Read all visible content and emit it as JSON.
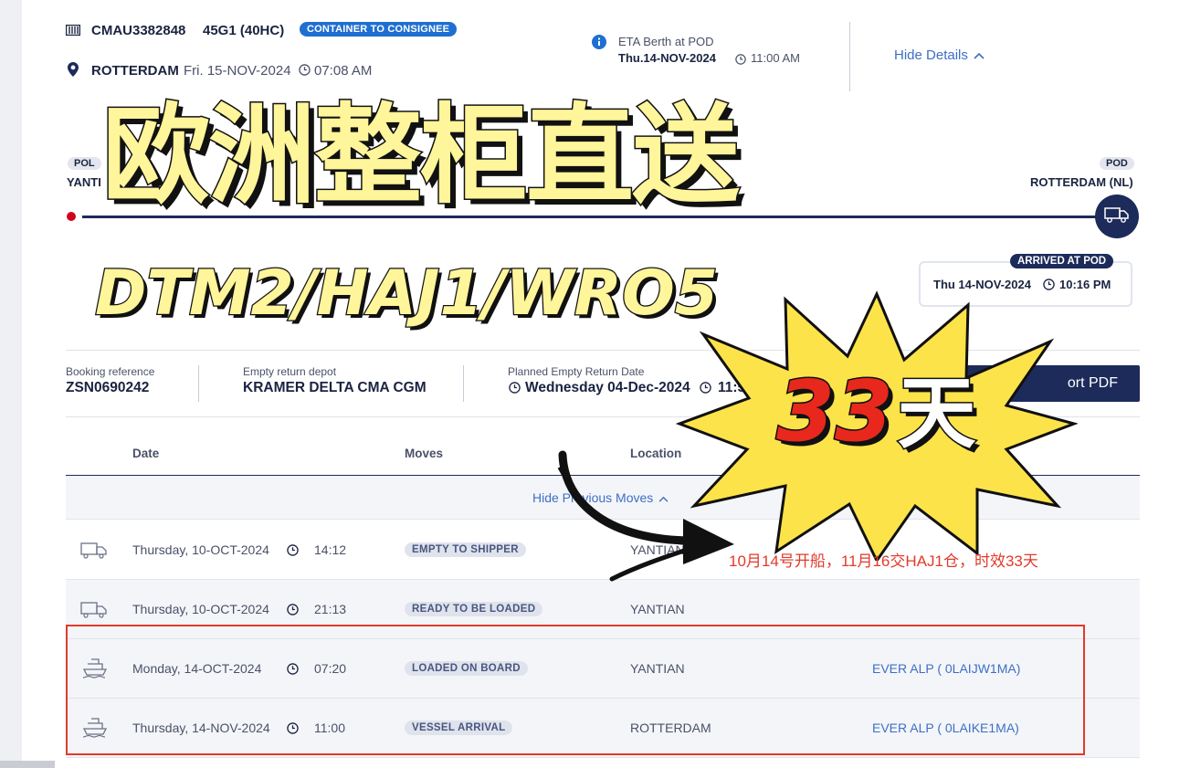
{
  "header": {
    "container_id": "CMAU3382848",
    "container_type": "45G1 (40HC)",
    "status_badge": "CONTAINER TO CONSIGNEE",
    "location": "ROTTERDAM",
    "location_date": "Fri. 15-NOV-2024",
    "location_time": "07:08 AM",
    "eta_label": "ETA Berth at POD",
    "eta_date": "Thu.14-NOV-2024",
    "eta_time": "11:00 AM",
    "hide_details": "Hide Details"
  },
  "route": {
    "pol_tag": "POL",
    "pol_name": "YANTI",
    "pod_tag": "POD",
    "pod_name": "ROTTERDAM (NL)",
    "arrived_tag": "ARRIVED AT POD",
    "arrived_date": "Thu 14-NOV-2024",
    "arrived_time": "10:16 PM"
  },
  "info": {
    "booking_label": "Booking reference",
    "booking_value": "ZSN0690242",
    "depot_label": "Empty return depot",
    "depot_value": "KRAMER DELTA CMA CGM",
    "planned_label": "Planned Empty Return Date",
    "planned_date": "Wednesday 04-Dec-2024",
    "planned_time": "11:5",
    "export_label": "ort PDF"
  },
  "table": {
    "headers": {
      "date": "Date",
      "moves": "Moves",
      "location": "Location"
    },
    "hide_previous": "Hide Previous Moves",
    "rows": [
      {
        "icon": "truck-icon",
        "date": "Thursday, 10-OCT-2024",
        "time": "14:12",
        "move": "EMPTY TO SHIPPER",
        "location": "YANTIAN",
        "vessel": ""
      },
      {
        "icon": "truck-icon",
        "date": "Thursday, 10-OCT-2024",
        "time": "21:13",
        "move": "READY TO BE LOADED",
        "location": "YANTIAN",
        "vessel": ""
      },
      {
        "icon": "ship-icon",
        "date": "Monday, 14-OCT-2024",
        "time": "07:20",
        "move": "LOADED ON BOARD",
        "location": "YANTIAN",
        "vessel": "EVER ALP ( 0LAIJW1MA)"
      },
      {
        "icon": "ship-icon",
        "date": "Thursday, 14-NOV-2024",
        "time": "11:00",
        "move": "VESSEL ARRIVAL",
        "location": "ROTTERDAM",
        "vessel": "EVER ALP ( 0LAIKE1MA)"
      }
    ]
  },
  "overlay": {
    "title": "欧洲整柜直送",
    "codes": "DTM2/HAJ1/WRO5",
    "days_number": "33",
    "days_unit": "天",
    "note": "10月14号开船，11月16交HAJ1仓，时效33天"
  },
  "colors": {
    "navy": "#1c2b5a",
    "link_blue": "#3d6fc6",
    "badge_blue": "#1f6fd1",
    "overlay_yellow": "#fff59a",
    "burst_yellow": "#fde34a",
    "highlight_red": "#e23a2b"
  }
}
